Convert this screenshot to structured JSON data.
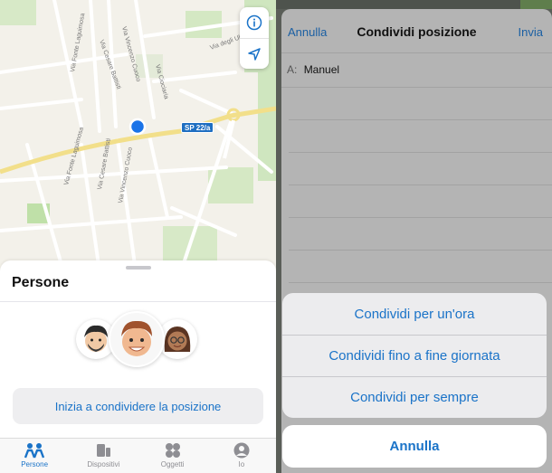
{
  "map": {
    "street_labels": [
      "Via Fonte Laguimosa",
      "Via Cesare Battisti",
      "Via Vincenzo Cuoco",
      "Via Ciociaria",
      "Via degli Ulivi",
      "Via Cesare Battisti",
      "Via Vincenzo Cuoco"
    ],
    "road_badge": "SP 22/a",
    "info_icon": "info-icon",
    "location_icon": "location-arrow-icon",
    "colors": {
      "land": "#f3f1ea",
      "park": "#cfe6bf",
      "road": "#ffffff",
      "main_road": "#f2df8a",
      "dot": "#1a73e8"
    }
  },
  "people_sheet": {
    "title": "Persone",
    "share_button": "Inizia a condividere la posizione",
    "memojis": [
      "memoji-man-beard",
      "memoji-man-smiling",
      "memoji-woman-glasses"
    ]
  },
  "tabs": [
    {
      "label": "Persone",
      "icon": "people-icon",
      "active": true
    },
    {
      "label": "Dispositivi",
      "icon": "devices-icon",
      "active": false
    },
    {
      "label": "Oggetti",
      "icon": "items-icon",
      "active": false
    },
    {
      "label": "Io",
      "icon": "person-icon",
      "active": false
    }
  ],
  "compose": {
    "cancel": "Annulla",
    "title": "Condividi posizione",
    "send": "Invia",
    "to_label": "A:",
    "to_value": "Manuel"
  },
  "action_sheet": {
    "options": [
      "Condividi per un'ora",
      "Condividi fino a fine giornata",
      "Condividi per sempre"
    ],
    "cancel": "Annulla"
  },
  "colors": {
    "accent": "#1a73c8",
    "sheet_gray": "#b4b4b4"
  }
}
